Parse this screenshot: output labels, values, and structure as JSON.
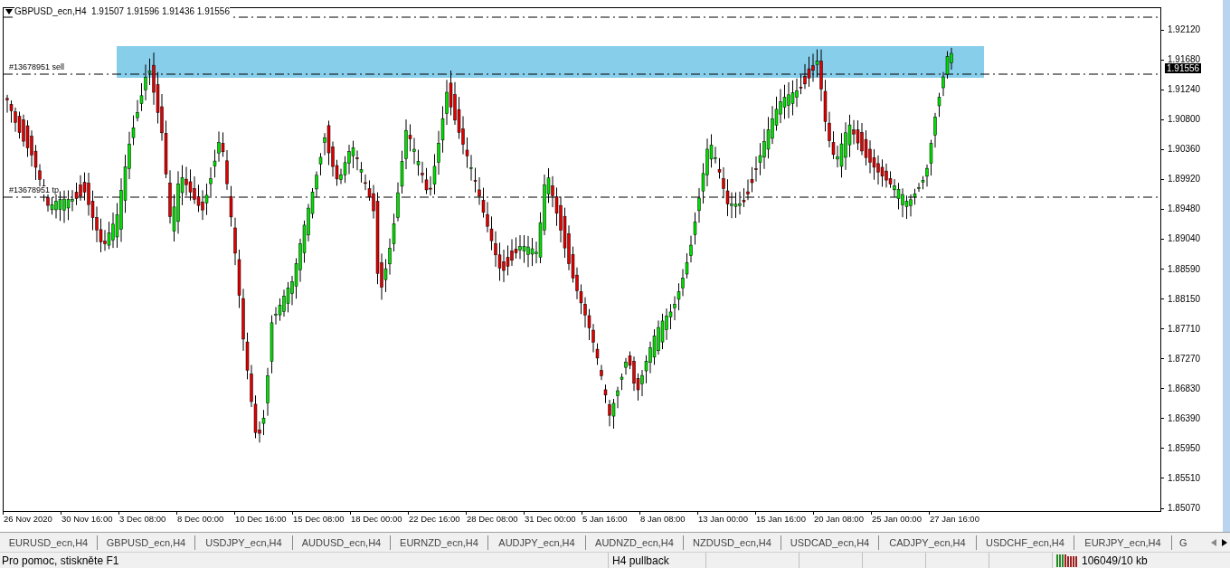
{
  "chart": {
    "title": "GBPUSD_ecn,H4  1.91507 1.91596 1.91436 1.91556",
    "order_lines": [
      {
        "label": "#13678951 sell"
      },
      {
        "label": "#13678951 tp"
      }
    ],
    "price_axis": [
      "1.92120",
      "1.91680",
      "1.91240",
      "1.90800",
      "1.90360",
      "1.89920",
      "1.89480",
      "1.89040",
      "1.88590",
      "1.88150",
      "1.87710",
      "1.87270",
      "1.86830",
      "1.86390",
      "1.85950",
      "1.85510",
      "1.85070"
    ],
    "current_price": "1.91556",
    "time_axis": [
      "26 Nov 2020",
      "30 Nov 16:00",
      "3 Dec 08:00",
      "8 Dec 00:00",
      "10 Dec 16:00",
      "15 Dec 08:00",
      "18 Dec 00:00",
      "22 Dec 16:00",
      "28 Dec 08:00",
      "31 Dec 00:00",
      "5 Jan 16:00",
      "8 Jan 08:00",
      "13 Jan 00:00",
      "15 Jan 16:00",
      "20 Jan 08:00",
      "25 Jan 00:00",
      "27 Jan 16:00"
    ]
  },
  "tabs": [
    "EURUSD_ecn,H4",
    "GBPUSD_ecn,H4",
    "USDJPY_ecn,H4",
    "AUDUSD_ecn,H4",
    "EURNZD_ecn,H4",
    "AUDJPY_ecn,H4",
    "AUDNZD_ecn,H4",
    "NZDUSD_ecn,H4",
    "USDCAD_ecn,H4",
    "CADJPY_ecn,H4",
    "USDCHF_ecn,H4",
    "EURJPY_ecn,H4",
    "G"
  ],
  "status_bar": {
    "help": "Pro pomoc, stiskněte F1",
    "profile": "H4 pullback",
    "traffic": "106049/10 kb"
  }
}
